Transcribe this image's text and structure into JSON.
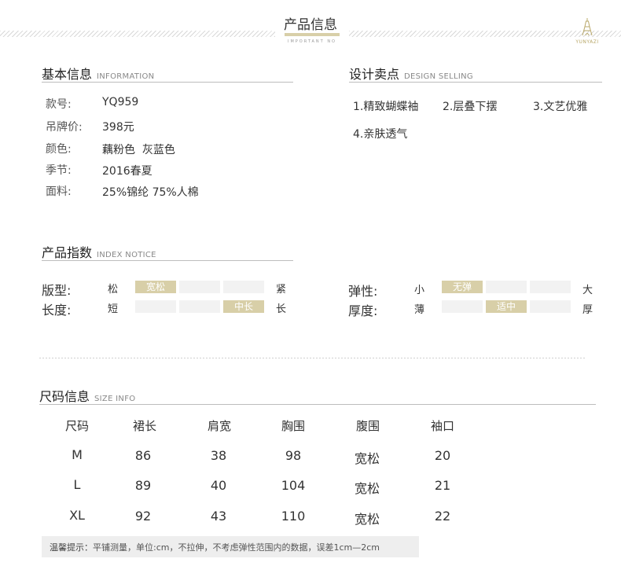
{
  "header": {
    "title": "产品信息",
    "subtitle": "IMPORTANT NO",
    "logo_text": "YUNYAZI"
  },
  "basic_info": {
    "title": "基本信息",
    "title_en": "INFORMATION",
    "rows": [
      {
        "label": "款号:",
        "value": "YQ959"
      },
      {
        "label": "吊牌价:",
        "value": "398元"
      },
      {
        "label": "颜色:",
        "value": "藕粉色  灰蓝色"
      },
      {
        "label": "季节:",
        "value": "2016春夏"
      },
      {
        "label": "面料:",
        "value": "25%锦纶 75%人棉"
      }
    ]
  },
  "design_selling": {
    "title": "设计卖点",
    "title_en": "DESIGN SELLING",
    "points": [
      "1.精致蝴蝶袖",
      "2.层叠下摆",
      "3.文艺优雅",
      "4.亲肤透气"
    ]
  },
  "index_notice": {
    "title": "产品指数",
    "title_en": "INDEX NOTICE",
    "scales": [
      {
        "label": "版型:",
        "low": "松",
        "high": "紧",
        "options": [
          "宽松",
          "",
          ""
        ],
        "selected": 0
      },
      {
        "label": "长度:",
        "low": "短",
        "high": "长",
        "options": [
          "",
          "",
          "中长"
        ],
        "selected": 2
      },
      {
        "label": "弹性:",
        "low": "小",
        "high": "大",
        "options": [
          "无弹",
          "",
          ""
        ],
        "selected": 0
      },
      {
        "label": "厚度:",
        "low": "薄",
        "high": "厚",
        "options": [
          "",
          "适中",
          ""
        ],
        "selected": 1
      }
    ]
  },
  "size_info": {
    "title": "尺码信息",
    "title_en": "SIZE INFO",
    "headers": [
      "尺码",
      "裙长",
      "肩宽",
      "胸围",
      "腹围",
      "袖口"
    ],
    "rows": [
      [
        "M",
        "86",
        "38",
        "98",
        "宽松",
        "20"
      ],
      [
        "L",
        "89",
        "40",
        "104",
        "宽松",
        "21"
      ],
      [
        "XL",
        "92",
        "43",
        "110",
        "宽松",
        "22"
      ]
    ],
    "note_label": "温馨提示：",
    "note": "平铺测量，单位:cm，不拉伸，不考虑弹性范围内的数据，误差1cm—2cm"
  },
  "colors": {
    "accent": "#d8cfa8",
    "segment_empty": "#f2f2f2",
    "rule": "#bdbdbd"
  }
}
